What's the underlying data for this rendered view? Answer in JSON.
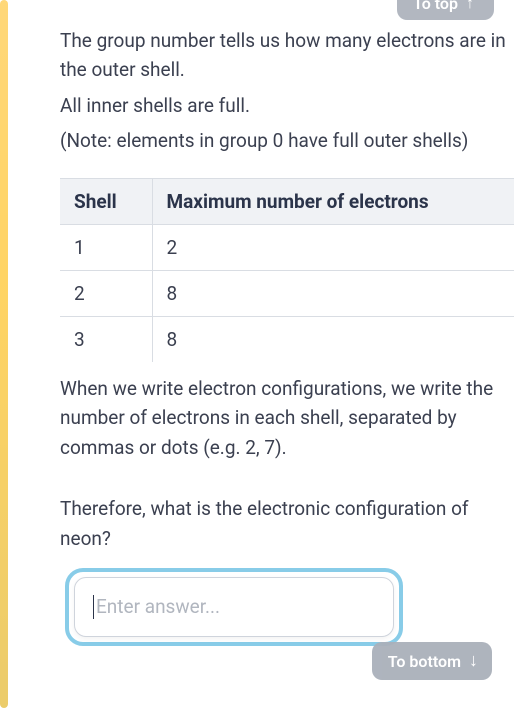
{
  "intro": {
    "line1": "The group number tells us how many electrons are in the outer shell.",
    "line2": "All inner shells are full.",
    "note": "(Note: elements in group 0 have full outer shells)"
  },
  "table": {
    "header_shell": "Shell",
    "header_max": "Maximum number of electrons",
    "rows": [
      {
        "shell": "1",
        "max": "2"
      },
      {
        "shell": "2",
        "max": "8"
      },
      {
        "shell": "3",
        "max": "8"
      }
    ]
  },
  "explain": "When we write electron configurations, we write the number of electrons in each shell, separated by commas or dots (e.g. 2, 7).",
  "question": "Therefore, what is the electronic configuration of neon?",
  "answer": {
    "placeholder": "Enter answer...",
    "value": ""
  },
  "nav": {
    "to_top": "To top",
    "to_bottom": "To bottom"
  },
  "icons": {
    "arrow_up": "↑",
    "arrow_down": "↓"
  }
}
